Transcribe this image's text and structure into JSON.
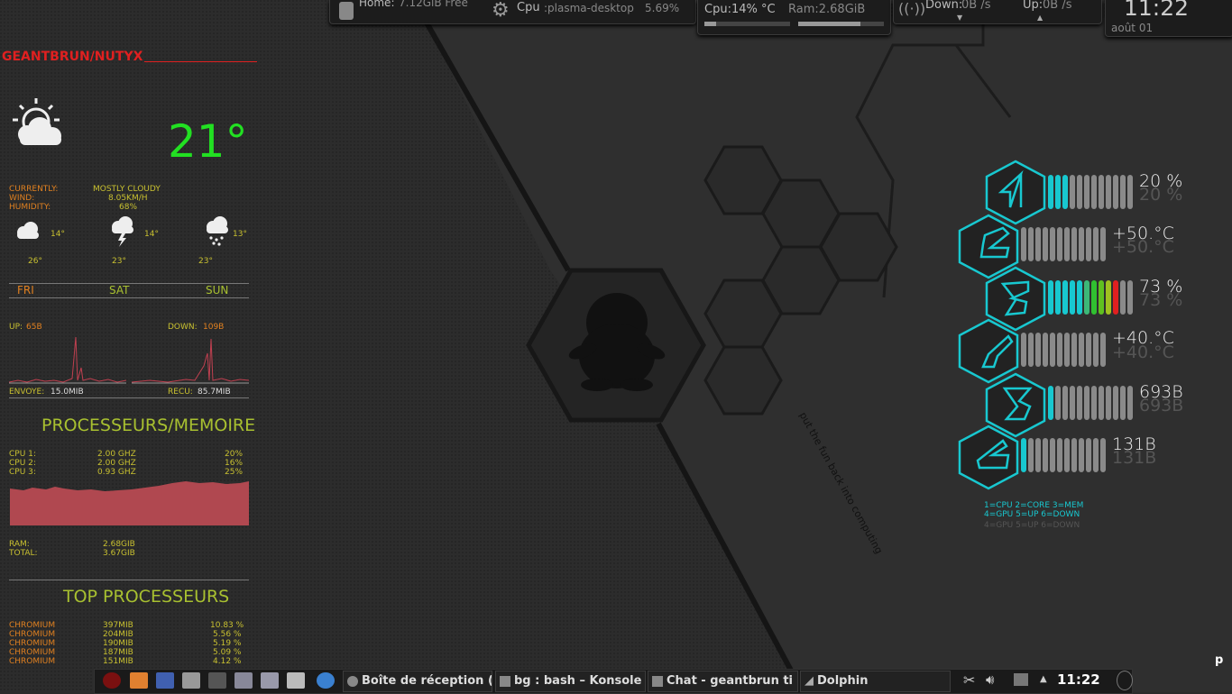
{
  "top_panel": {
    "home_label": "Home:",
    "home_value": "7.12GiB Free",
    "cpu_label": "Cpu",
    "cpu_process": ":plasma-desktop",
    "cpu_pct": "5.69%",
    "cpu_usage": "Cpu:14% °C",
    "ram_usage": "Ram:2.68GiB",
    "down_label": "Down:",
    "down_value": "0B  /s",
    "up_label": "Up:",
    "up_value": "0B  /s",
    "clock": "11:22",
    "date": "août 01"
  },
  "left": {
    "host": "GEANTBRUN/NUTYX",
    "temperature": "21°",
    "currently_label": "CURRENTLY:",
    "currently_value": "MOSTLY CLOUDY",
    "wind_label": "WIND:",
    "wind_value": "8.05KM/H",
    "humidity_label": "HUMIDITY:",
    "humidity_value": "68%",
    "forecast": [
      {
        "low": "14°",
        "high": "26°",
        "day": "FRI",
        "icon": "cloud-icon"
      },
      {
        "low": "14°",
        "high": "23°",
        "day": "SAT",
        "icon": "storm-icon"
      },
      {
        "low": "13°",
        "high": "23°",
        "day": "SUN",
        "icon": "rain-icon"
      }
    ],
    "up_label": "UP:",
    "up_value": "65B",
    "down_label": "DOWN:",
    "down_value": "109B",
    "sent_label": "ENVOYE:",
    "sent_value": "15.0MIB",
    "recv_label": "RECU:",
    "recv_value": "85.7MIB",
    "proc_title": "PROCESSEURS/MEMOIRE",
    "cpus": [
      {
        "name": "CPU 1:",
        "freq": "2.00 GHZ",
        "pct": "20%"
      },
      {
        "name": "CPU 2:",
        "freq": "2.00 GHZ",
        "pct": "16%"
      },
      {
        "name": "CPU 3:",
        "freq": "0.93 GHZ",
        "pct": "25%"
      }
    ],
    "ram_label": "RAM:",
    "ram_value": "2.68GIB",
    "total_label": "TOTAL:",
    "total_value": "3.67GIB",
    "top_title": "TOP PROCESSEURS",
    "top": [
      {
        "name": "CHROMIUM",
        "mem": "397MIB",
        "pct": "10.83 %"
      },
      {
        "name": "CHROMIUM",
        "mem": "204MIB",
        "pct": "5.56 %"
      },
      {
        "name": "CHROMIUM",
        "mem": "190MIB",
        "pct": "5.19 %"
      },
      {
        "name": "CHROMIUM",
        "mem": "187MIB",
        "pct": "5.09 %"
      },
      {
        "name": "CHROMIUM",
        "mem": "151MIB",
        "pct": "4.12 %"
      }
    ]
  },
  "gauges": [
    {
      "id": "1",
      "value": "20 %",
      "level": 0.2
    },
    {
      "id": "2",
      "value": "+50.°C",
      "level": 0.0
    },
    {
      "id": "3",
      "value": "73 %",
      "level": 0.73
    },
    {
      "id": "4",
      "value": "+40.°C",
      "level": 0.0
    },
    {
      "id": "5",
      "value": "693B",
      "level": 0.1
    },
    {
      "id": "6",
      "value": "131B",
      "level": 0.1
    }
  ],
  "legend_line1": "1=CPU 2=CORE 3=MEM",
  "legend_line2": "4=GPU 5=UP 6=DOWN",
  "wallpaper_text": "put the fun back into computing",
  "taskbar": {
    "tasks": [
      "Boîte de réception (",
      "bg : bash – Konsole",
      "Chat - geantbrun ti",
      "Dolphin"
    ],
    "clock": "11:22",
    "corner": "p"
  },
  "colors": {
    "accent_cyan": "#18c8d0",
    "ram_graph": "#b04850",
    "title_green": "#a8c030",
    "host_red": "#e02020"
  }
}
